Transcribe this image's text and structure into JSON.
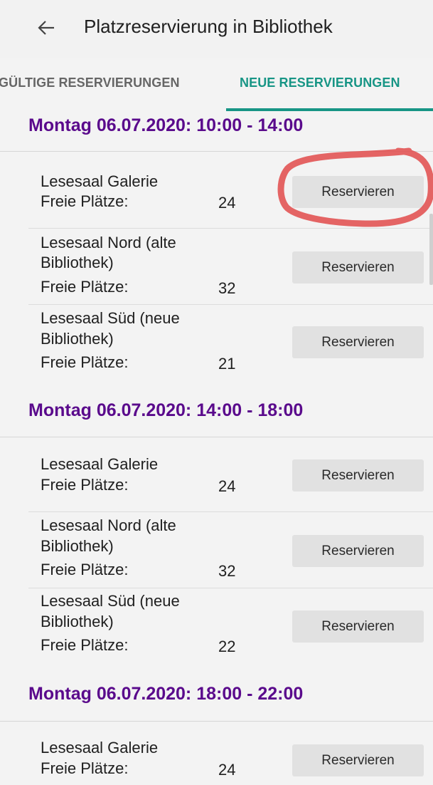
{
  "appbar": {
    "back_icon": "arrow-left-icon",
    "title": "Platzreservierung in Bibliothek"
  },
  "tabs": [
    {
      "label": "GÜLTIGE RESERVIERUNGEN",
      "active": false
    },
    {
      "label": "NEUE RESERVIERUNGEN",
      "active": true
    }
  ],
  "colors": {
    "accent": "#179585",
    "section_header": "#5a0a8c",
    "annotation": "#e04a4a"
  },
  "sections": [
    {
      "header": "Montag 06.07.2020: 10:00 - 14:00",
      "rooms": [
        {
          "name_lines": [
            "Lesesaal Galerie"
          ],
          "free_label": "Freie Plätze:",
          "free": "24",
          "button": "Reservieren"
        },
        {
          "name_lines": [
            "Lesesaal Nord (alte",
            "Bibliothek)"
          ],
          "free_label": "Freie Plätze:",
          "free": "32",
          "button": "Reservieren"
        },
        {
          "name_lines": [
            "Lesesaal Süd (neue",
            "Bibliothek)"
          ],
          "free_label": "Freie Plätze:",
          "free": "21",
          "button": "Reservieren"
        }
      ]
    },
    {
      "header": "Montag 06.07.2020: 14:00 - 18:00",
      "rooms": [
        {
          "name_lines": [
            "Lesesaal Galerie"
          ],
          "free_label": "Freie Plätze:",
          "free": "24",
          "button": "Reservieren"
        },
        {
          "name_lines": [
            "Lesesaal Nord (alte",
            "Bibliothek)"
          ],
          "free_label": "Freie Plätze:",
          "free": "32",
          "button": "Reservieren"
        },
        {
          "name_lines": [
            "Lesesaal Süd (neue",
            "Bibliothek)"
          ],
          "free_label": "Freie Plätze:",
          "free": "22",
          "button": "Reservieren"
        }
      ]
    },
    {
      "header": "Montag 06.07.2020: 18:00 - 22:00",
      "rooms": [
        {
          "name_lines": [
            "Lesesaal Galerie"
          ],
          "free_label": "Freie Plätze:",
          "free": "24",
          "button": "Reservieren"
        }
      ]
    }
  ]
}
